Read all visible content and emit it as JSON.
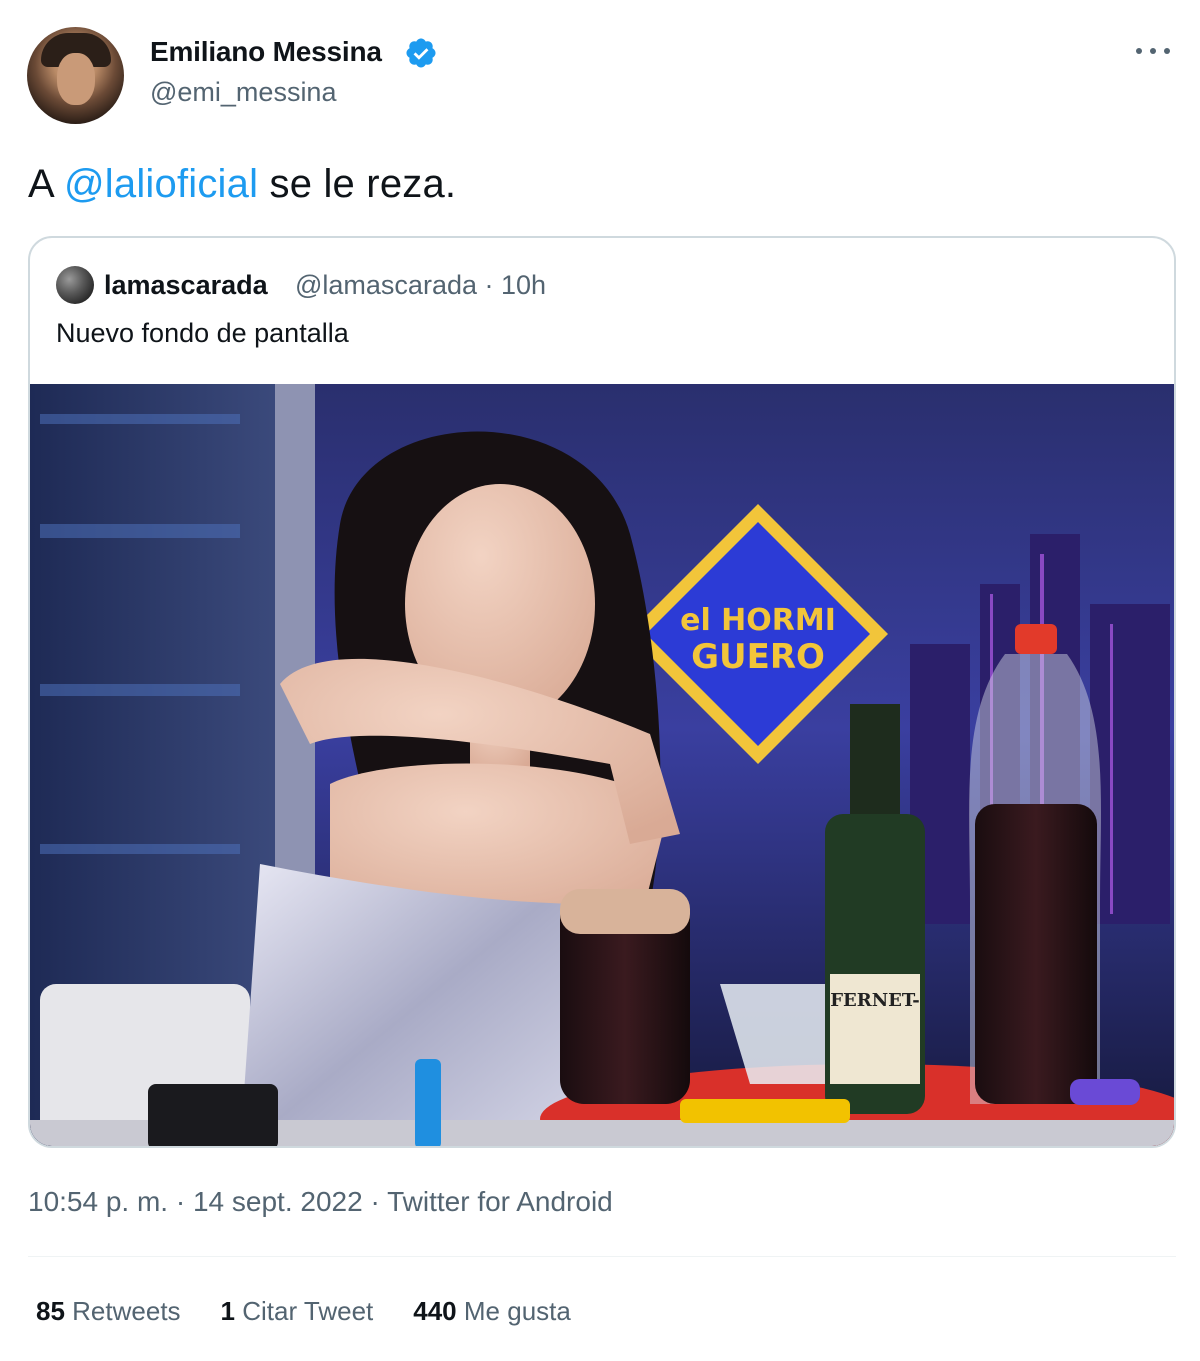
{
  "author": {
    "name": "Emiliano Messina",
    "handle": "@emi_messina",
    "verified_color": "#1d9bf0"
  },
  "tweet": {
    "prefix": "A ",
    "mention": "@lalioficial",
    "suffix": " se le reza."
  },
  "quote": {
    "name": "lamascarada",
    "meta": "@lamascarada · 10h",
    "text": "Nuevo fondo de pantalla",
    "media": {
      "sign_line1": "el HORMI",
      "sign_line2": "GUERO",
      "bottle_label": "FERNET-"
    }
  },
  "footer": {
    "time": "10:54 p. m.",
    "sep1": " · ",
    "date": "14 sept. 2022",
    "sep2": " · ",
    "source": "Twitter for Android"
  },
  "stats": [
    {
      "count": "85",
      "label": "Retweets"
    },
    {
      "count": "1",
      "label": "Citar Tweet"
    },
    {
      "count": "440",
      "label": "Me gusta"
    }
  ],
  "colors": {
    "link": "#1d9bf0",
    "secondary_text": "#536471",
    "border": "#cfd9de"
  },
  "icons": [
    "verified-badge-icon",
    "more-options-icon"
  ]
}
